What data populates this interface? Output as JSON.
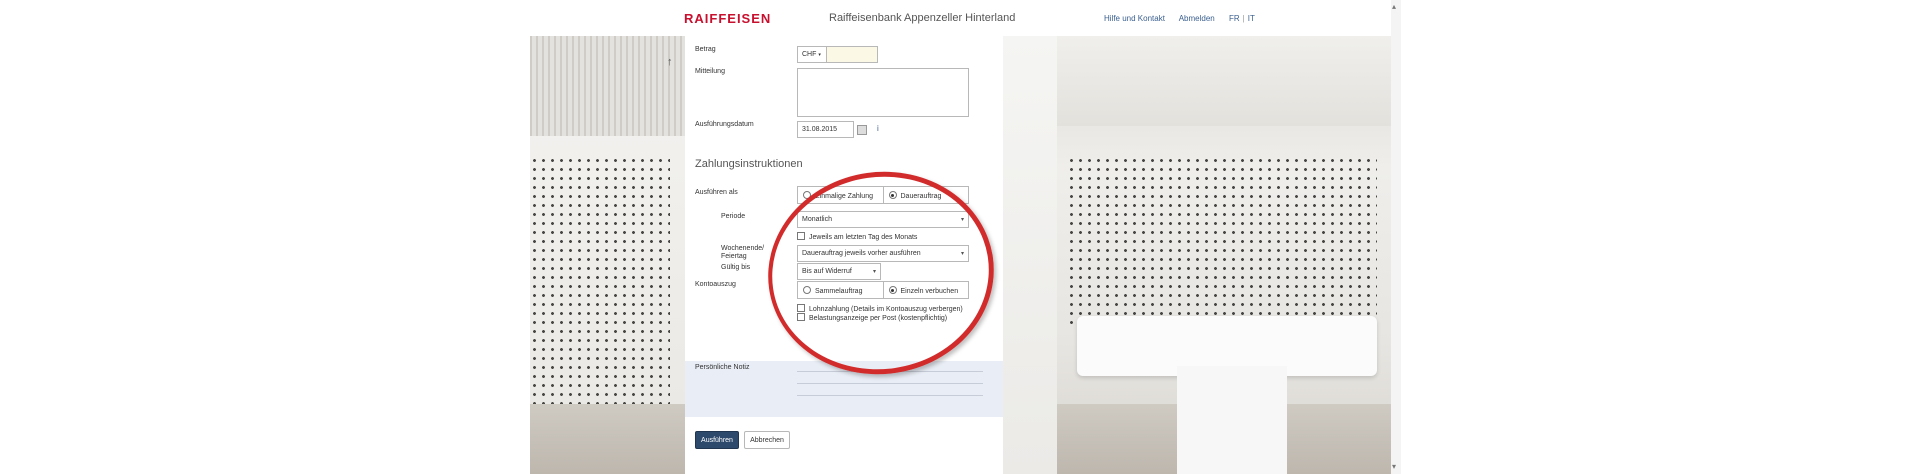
{
  "header": {
    "logo": "RAIFFEISEN",
    "bank_name": "Raiffeisenbank Appenzeller Hinterland",
    "help_link": "Hilfe und Kontakt",
    "logout_link": "Abmelden",
    "lang_fr": "FR",
    "lang_separator": "|",
    "lang_it": "IT"
  },
  "form": {
    "amount_label": "Betrag",
    "currency": "CHF",
    "currency_caret": "▾",
    "amount_value": "",
    "message_label": "Mitteilung",
    "message_value": "",
    "date_label": "Ausführungsdatum",
    "date_value": "31.08.2015",
    "info_icon": "i",
    "section_title": "Zahlungsinstruktionen",
    "execute_as_label": "Ausführen als",
    "execute_options": [
      "Einmalige Zahlung",
      "Dauerauftrag"
    ],
    "execute_selected": "Dauerauftrag",
    "period_label": "Periode",
    "period_value": "Monatlich",
    "last_day_checkbox": "Jeweils am letzten Tag des Monats",
    "weekend_label_1": "Wochenende/",
    "weekend_label_2": "Feiertag",
    "weekend_value": "Dauerauftrag jeweils vorher ausführen",
    "valid_until_label": "Gültig bis",
    "valid_until_value": "Bis auf Widerruf",
    "statement_label": "Kontoauszug",
    "statement_options": [
      "Sammelauftrag",
      "Einzeln verbuchen"
    ],
    "statement_selected": "Einzeln verbuchen",
    "salary_checkbox": "Lohnzahlung (Details im Kontoauszug verbergen)",
    "debit_notice_checkbox": "Belastungsanzeige per Post (kostenpflichtig)",
    "personal_note_label": "Persönliche Notiz",
    "submit_button": "Ausführen",
    "cancel_button": "Abbrechen"
  },
  "icons": {
    "back": "↑",
    "caret": "▾",
    "scroll_up": "▴",
    "scroll_down": "▾"
  },
  "colors": {
    "brand_red": "#c8102e",
    "link_blue": "#3a5f8f",
    "primary_button": "#2d4a6d",
    "annotation_circle": "#d22b2b"
  }
}
